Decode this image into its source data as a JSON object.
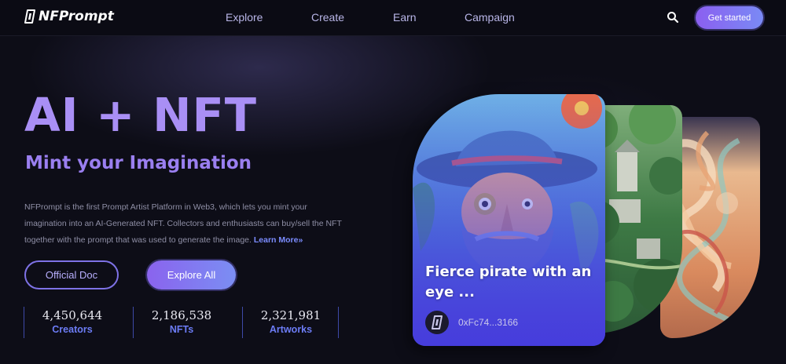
{
  "nav": {
    "logo_text": "NFPrompt",
    "links": [
      {
        "label": "Explore"
      },
      {
        "label": "Create"
      },
      {
        "label": "Earn"
      },
      {
        "label": "Campaign"
      }
    ],
    "search_icon": "search-icon",
    "cta_label": "Get started"
  },
  "hero": {
    "title": "AI + NFT",
    "subtitle": "Mint your Imagination",
    "description_lines": [
      "NFPrompt is the first Prompt Artist Platform in Web3, which lets you mint your",
      "imagination into an AI-Generated NFT. Collectors and enthusiasts can buy/sell the NFT",
      "together with the prompt that was used to generate the image."
    ],
    "learn_more": "Learn More»",
    "primary_button": "Explore All",
    "secondary_button": "Official Doc",
    "stats": [
      {
        "value": "4,450,644",
        "label": "Creators"
      },
      {
        "value": "2,186,538",
        "label": "NFTs"
      },
      {
        "value": "2,321,981",
        "label": "Artworks"
      }
    ]
  },
  "featured": {
    "title": "Fierce pirate with an eye ...",
    "owner": "0xFc74...3166"
  },
  "colors": {
    "background": "#0d0d17",
    "accent": "#8b5ff0",
    "title_purple": "#a98ff5",
    "stat_label": "#6c7cf5"
  }
}
